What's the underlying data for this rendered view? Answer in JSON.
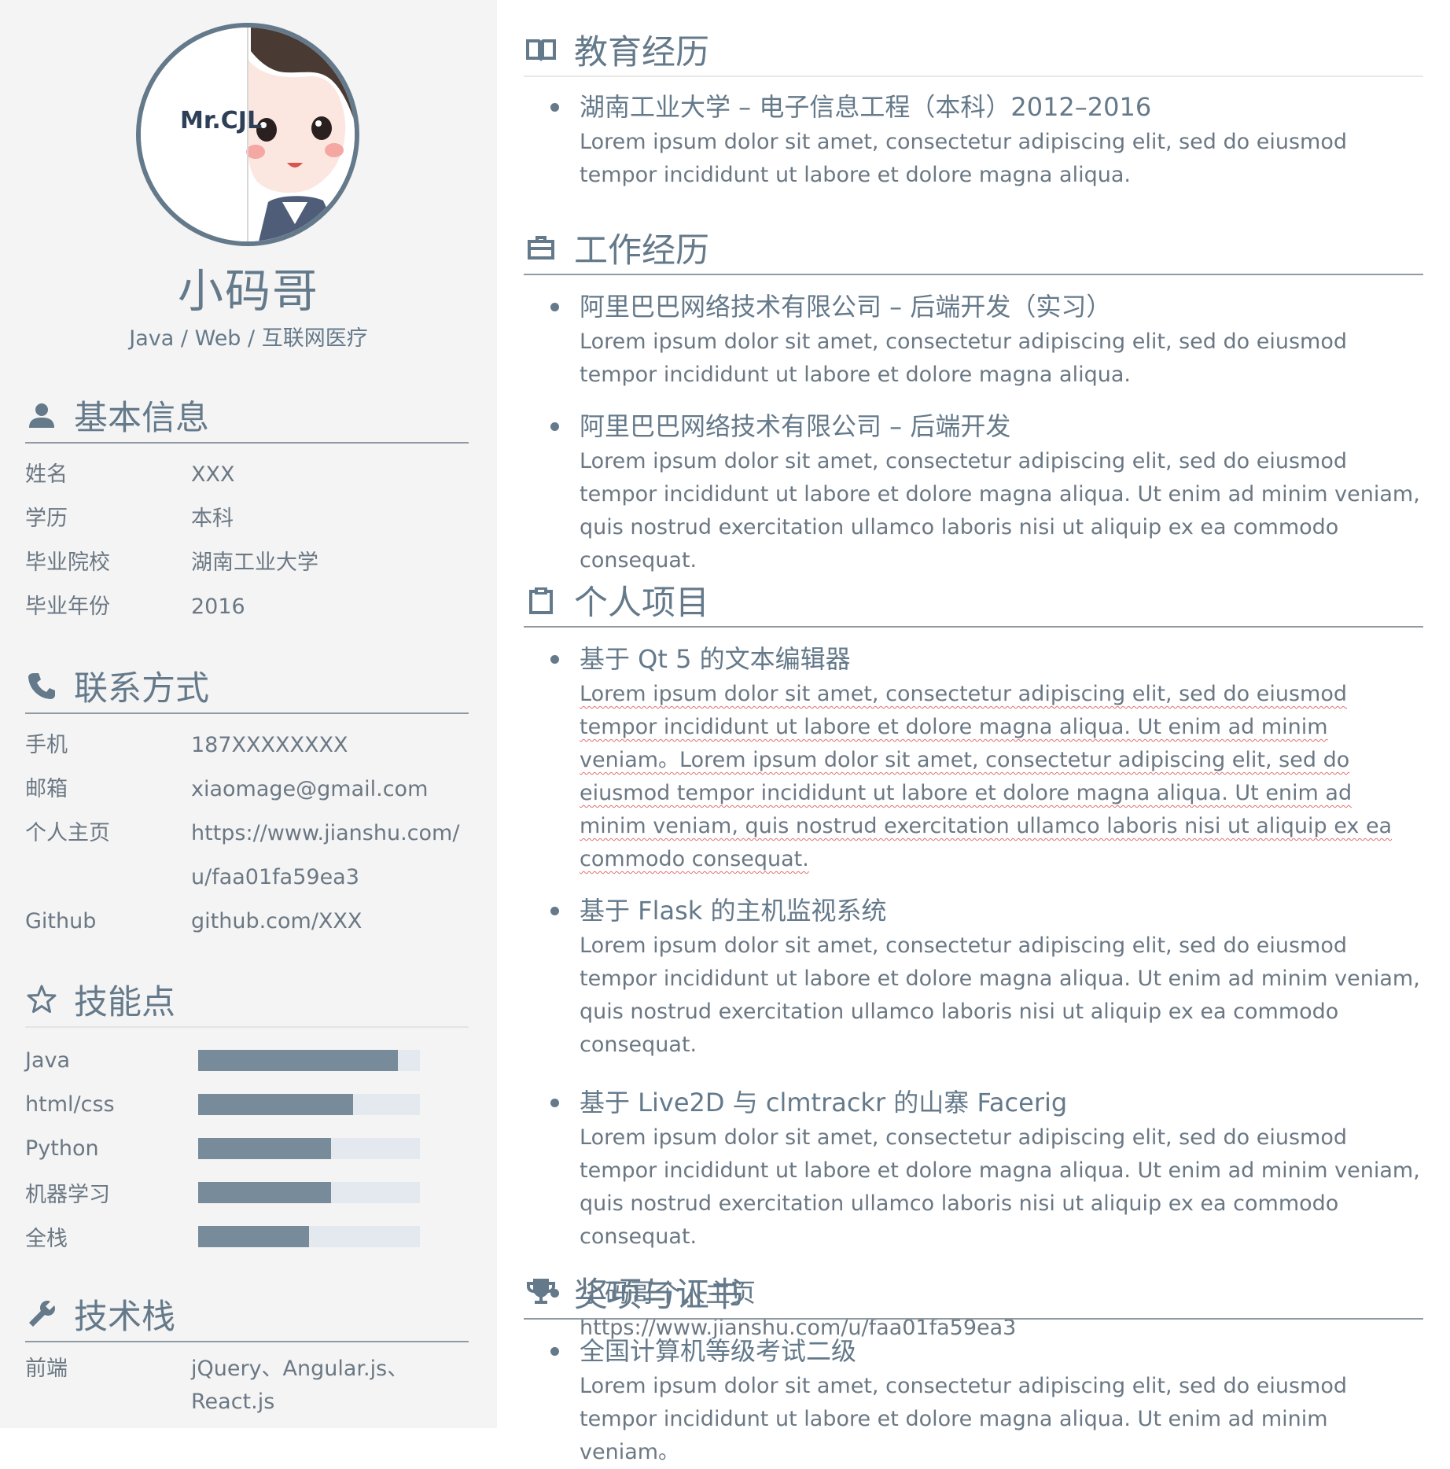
{
  "profile": {
    "avatar_text": "Mr.CJL",
    "name": "小码哥",
    "title": "Java / Web / 互联网医疗"
  },
  "basic_info": {
    "heading": "基本信息",
    "rows": [
      {
        "label": "姓名",
        "value": "XXX"
      },
      {
        "label": "学历",
        "value": "本科"
      },
      {
        "label": "毕业院校",
        "value": "湖南工业大学"
      },
      {
        "label": "毕业年份",
        "value": "2016"
      }
    ]
  },
  "contact": {
    "heading": "联系方式",
    "rows": [
      {
        "label": "手机",
        "value": "187XXXXXXXX"
      },
      {
        "label": "邮箱",
        "value": "xiaomage@gmail.com"
      },
      {
        "label": "个人主页",
        "value": "https://www.jianshu.com/",
        "value2": "u/faa01fa59ea3"
      },
      {
        "label": "Github",
        "value": "github.com/XXX"
      }
    ]
  },
  "skills": {
    "heading": "技能点",
    "items": [
      {
        "name": "Java",
        "level": 0.9
      },
      {
        "name": "html/css",
        "level": 0.7
      },
      {
        "name": "Python",
        "level": 0.6
      },
      {
        "name": "机器学习",
        "level": 0.6
      },
      {
        "name": "全栈",
        "level": 0.5
      }
    ]
  },
  "tech_stack": {
    "heading": "技术栈",
    "rows": [
      {
        "label": "前端",
        "value": "jQuery、Angular.js、React.js"
      }
    ]
  },
  "education": {
    "heading": "教育经历",
    "entries": [
      {
        "title": "湖南工业大学 – 电子信息工程（本科）2012–2016",
        "desc": "Lorem ipsum dolor sit amet, consectetur adipiscing elit, sed do eiusmod tempor incididunt ut labore et dolore magna aliqua."
      }
    ]
  },
  "work": {
    "heading": "工作经历",
    "entries": [
      {
        "title": "阿里巴巴网络技术有限公司 – 后端开发（实习）",
        "desc": "Lorem ipsum dolor sit amet, consectetur adipiscing elit, sed do eiusmod tempor incididunt ut labore et dolore magna aliqua."
      },
      {
        "title": "阿里巴巴网络技术有限公司 – 后端开发",
        "desc": "Lorem ipsum dolor sit amet, consectetur adipiscing elit, sed do eiusmod tempor incididunt ut labore et dolore magna aliqua. Ut enim ad minim veniam, quis nostrud exercitation ullamco laboris nisi ut aliquip ex ea commodo consequat."
      }
    ]
  },
  "projects": {
    "heading": "个人项目",
    "entries": [
      {
        "title": "基于 Qt 5 的文本编辑器",
        "desc": "Lorem ipsum dolor sit amet, consectetur adipiscing elit, sed do eiusmod tempor incididunt ut labore et dolore magna aliqua. Ut enim ad minim veniam。Lorem ipsum dolor sit amet, consectetur adipiscing elit, sed do eiusmod tempor incididunt ut labore et dolore magna aliqua. Ut enim ad minim veniam, quis nostrud exercitation ullamco laboris nisi ut aliquip ex ea commodo consequat."
      },
      {
        "title": "基于 Flask 的主机监视系统",
        "desc": "Lorem ipsum dolor sit amet, consectetur adipiscing elit, sed do eiusmod tempor incididunt ut labore et dolore magna aliqua. Ut enim ad minim veniam, quis nostrud exercitation ullamco laboris nisi ut aliquip ex ea commodo consequat."
      },
      {
        "title": "基于 Live2D 与 clmtrackr 的山寨 Facerig",
        "desc": "Lorem ipsum dolor sit amet, consectetur adipiscing elit, sed do eiusmod tempor incididunt ut labore et dolore magna aliqua. Ut enim ad minim veniam, quis nostrud exercitation ullamco laboris nisi ut aliquip ex ea commodo consequat."
      },
      {
        "title": "小码哥个人主页",
        "desc": "https://www.jianshu.com/u/faa01fa59ea3"
      }
    ]
  },
  "awards": {
    "heading": "奖项与证书",
    "entries": [
      {
        "title": "全国计算机等级考试二级",
        "desc": "Lorem ipsum dolor sit amet, consectetur adipiscing elit, sed do eiusmod tempor incididunt ut labore et dolore magna aliqua. Ut enim ad minim veniam。"
      }
    ]
  },
  "colors": {
    "accent": "#64798a",
    "text": "#6b7884",
    "sidebar_bg": "#f4f4f4",
    "bar_fill": "#778b9b",
    "bar_track": "#e3e9ef"
  },
  "icons": {
    "education": "book-open-icon",
    "work": "briefcase-icon",
    "projects": "clipboard-icon",
    "awards": "trophy-icon",
    "basic_info": "user-icon",
    "contact": "phone-icon",
    "skills": "star-outline-icon",
    "tech_stack": "wrench-icon"
  }
}
